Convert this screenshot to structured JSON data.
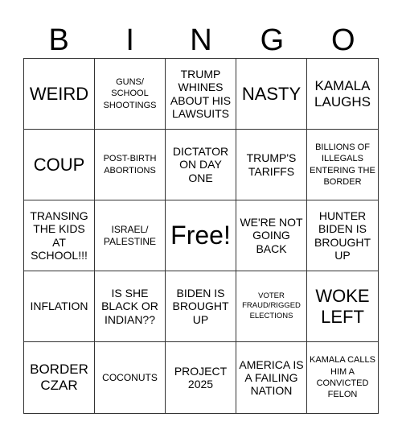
{
  "header": {
    "letters": [
      "B",
      "I",
      "N",
      "G",
      "O"
    ]
  },
  "cells": [
    "WEIRD",
    "GUNS/ SCHOOL SHOOTINGS",
    "TRUMP WHINES ABOUT HIS LAWSUITS",
    "NASTY",
    "KAMALA LAUGHS",
    "COUP",
    "POST-BIRTH ABORTIONS",
    "DICTATOR ON DAY ONE",
    "TRUMP'S TARIFFS",
    "BILLIONS OF ILLEGALS ENTERING THE BORDER",
    "TRANSING THE KIDS AT SCHOOL!!!",
    "ISRAEL/ PALESTINE",
    "Free!",
    "WE'RE NOT GOING BACK",
    "HUNTER BIDEN IS BROUGHT UP",
    "INFLATION",
    "IS SHE BLACK OR INDIAN??",
    "BIDEN IS BROUGHT UP",
    "VOTER FRAUD/RIGGED ELECTIONS",
    "WOKE LEFT",
    "BORDER CZAR",
    "COCONUTS",
    "PROJECT 2025",
    "AMERICA IS A FAILING NATION",
    "KAMALA CALLS HIM A CONVICTED FELON"
  ],
  "colors": {
    "background": "#ffffff",
    "text": "#000000",
    "grid_line": "#333333"
  }
}
